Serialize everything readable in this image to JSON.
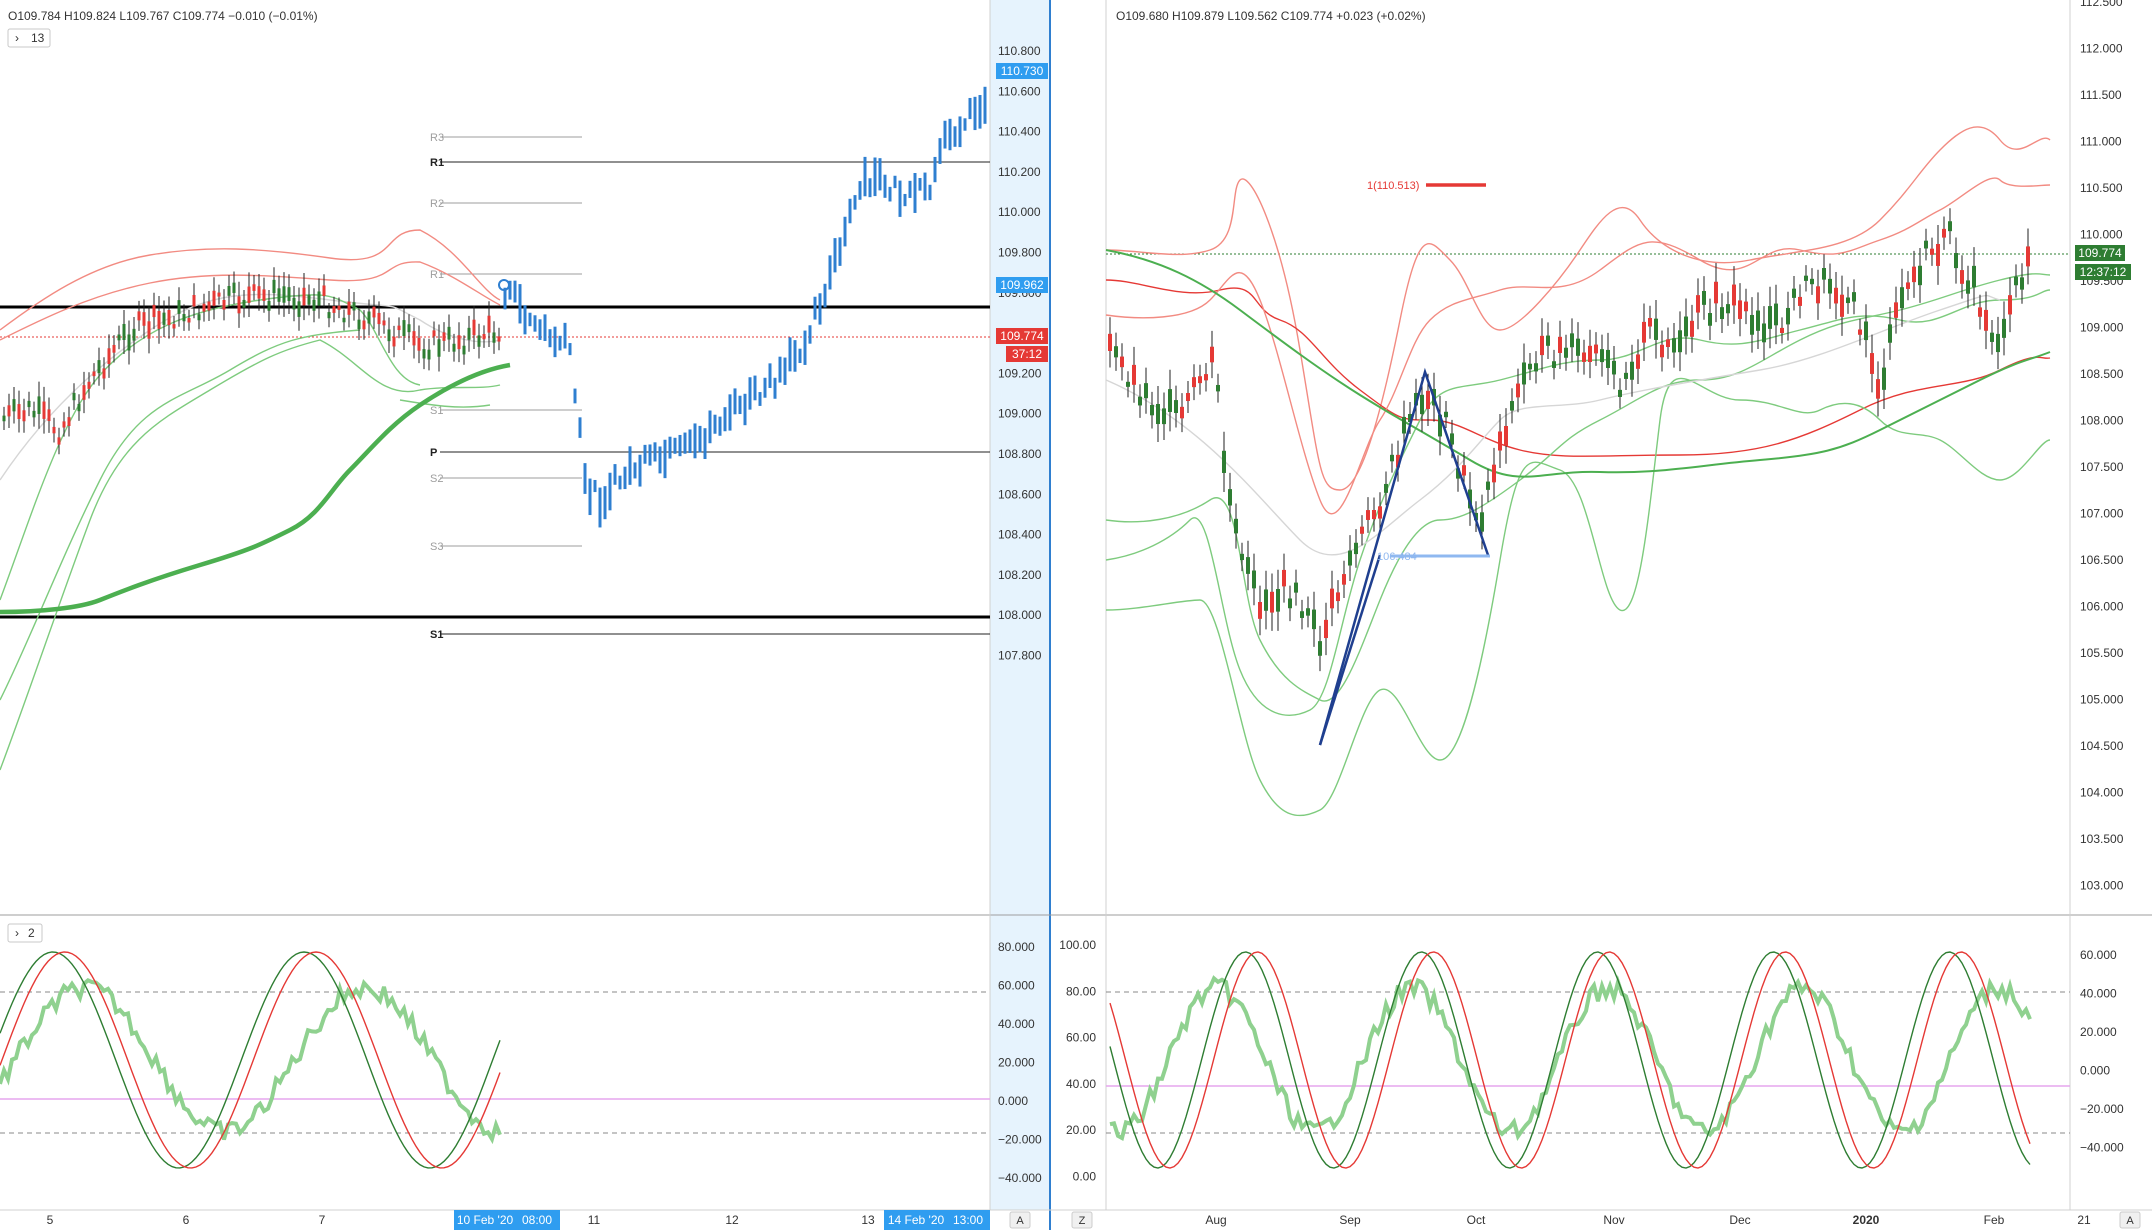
{
  "left": {
    "ohlc": "O109.784  H109.824  L109.767  C109.774  −0.010 (−0.01%)",
    "indicator_toggle": "13",
    "price_axis": [
      "110.800",
      "110.600",
      "110.400",
      "110.200",
      "110.000",
      "109.800",
      "109.600",
      "109.400",
      "109.200",
      "109.000",
      "108.800",
      "108.600",
      "108.400",
      "108.200",
      "108.000",
      "107.800"
    ],
    "price_tag_blue": "110.730",
    "price_tag_blue2": "109.962",
    "price_tag_red": "109.774",
    "countdown": "37:12",
    "levels": [
      "R3",
      "R1",
      "R2",
      "R1",
      "P",
      "S1",
      "S2",
      "S3",
      "S1"
    ],
    "osc_toggle": "2",
    "osc_axis": [
      "80.000",
      "60.000",
      "40.000",
      "20.000",
      "0.000",
      "−20.000",
      "−40.000"
    ],
    "time_axis": [
      "5",
      "6",
      "7",
      "10 Feb '20",
      "08:00",
      "11",
      "12",
      "13",
      "14 Feb '20",
      "13:00"
    ],
    "auto_btn": "A"
  },
  "right": {
    "ohlc": "O109.680  H109.879  L109.562  C109.774  +0.023 (+0.02%)",
    "price_axis": [
      "112.500",
      "112.000",
      "111.500",
      "111.000",
      "110.500",
      "110.000",
      "109.500",
      "109.000",
      "108.500",
      "108.000",
      "107.500",
      "107.000",
      "106.500",
      "106.000",
      "105.500",
      "105.000",
      "104.500",
      "104.000",
      "103.500",
      "103.000"
    ],
    "price_tag": "109.774",
    "countdown": "12:37:12",
    "fib_label": "1(110.513)",
    "abcd_label": "106.484",
    "osc_left_axis": [
      "100.00",
      "80.00",
      "60.00",
      "40.00",
      "20.00",
      "0.00"
    ],
    "osc_right_axis": [
      "60.000",
      "40.000",
      "20.000",
      "0.000",
      "−20.000",
      "−40.000"
    ],
    "time_axis": [
      "Aug",
      "Sep",
      "Oct",
      "Nov",
      "Dec",
      "2020",
      "Feb",
      "21"
    ],
    "zoom_btn": "Z",
    "auto_btn": "A"
  },
  "colors": {
    "up": "#2e7d32",
    "down": "#e53935",
    "blue": "#2f7fd0",
    "band_red": "#f28b82",
    "band_green": "#7ecb7e"
  }
}
